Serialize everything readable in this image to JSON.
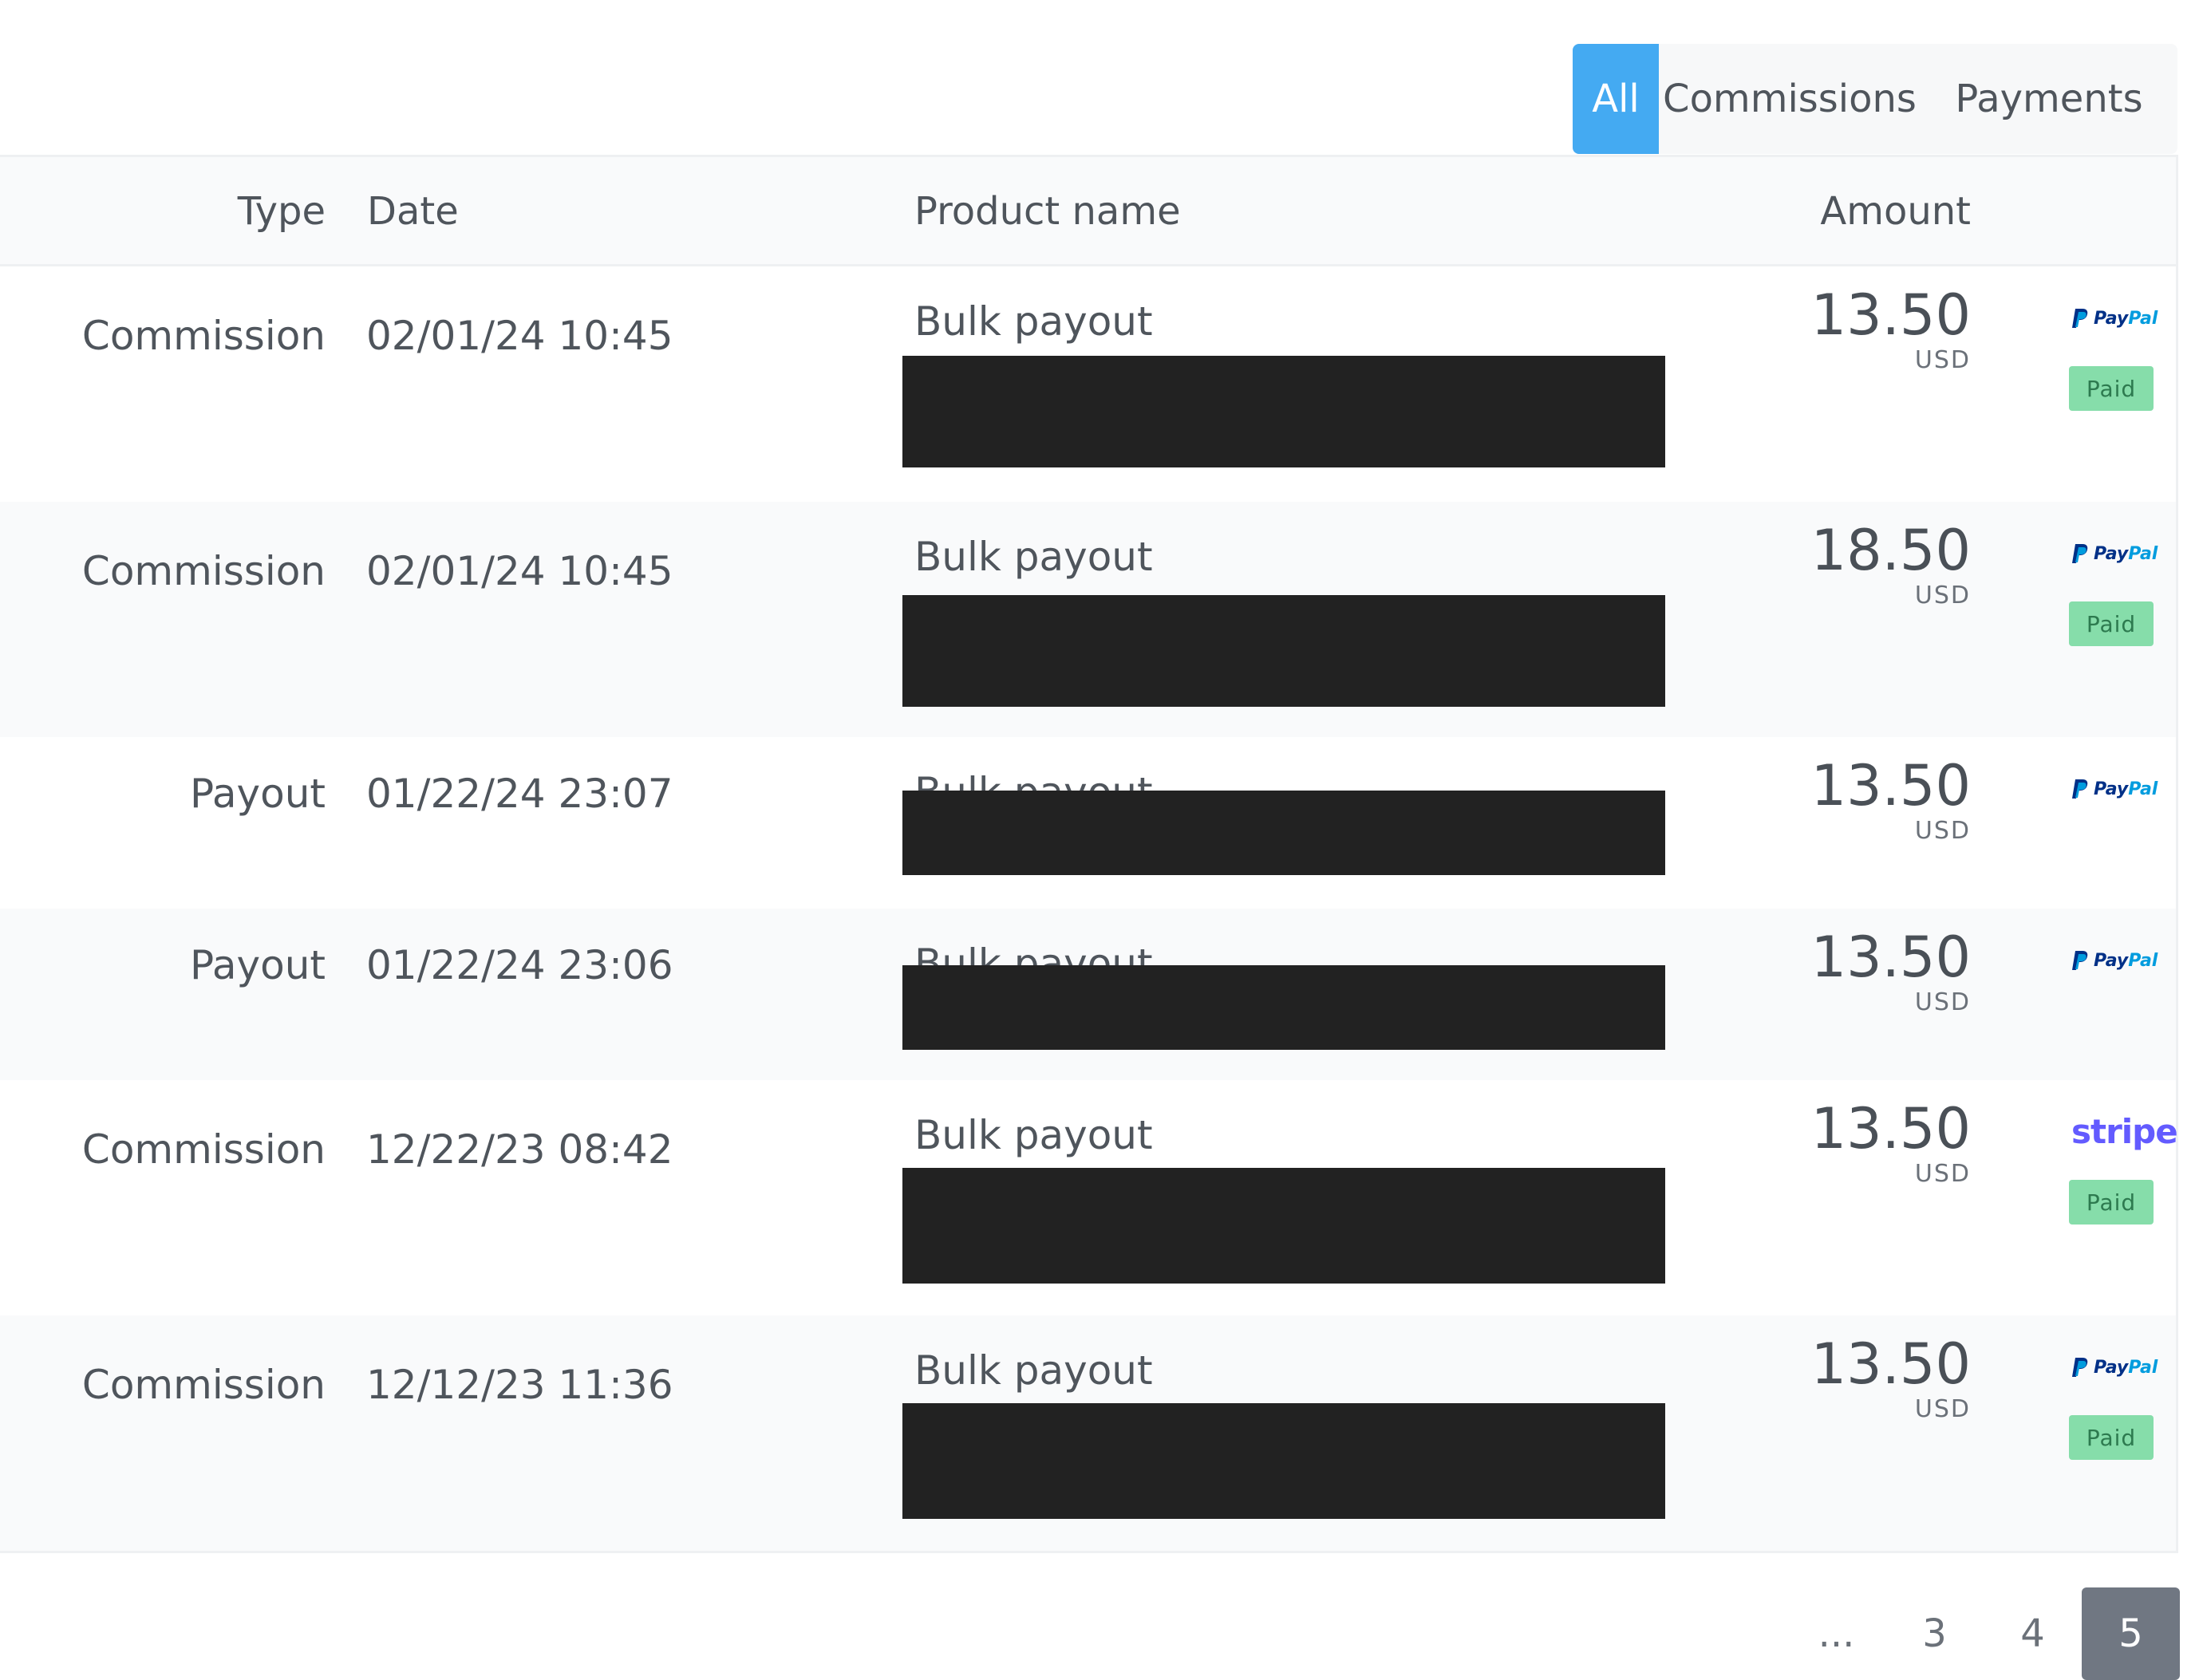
{
  "tabs": {
    "all": "All",
    "commissions": "Commissions",
    "payments": "Payments",
    "active": "All"
  },
  "table": {
    "headers": {
      "type": "Type",
      "date": "Date",
      "product": "Product name",
      "amount": "Amount"
    },
    "rows": [
      {
        "type": "Commission",
        "date": "02/01/24 10:45",
        "product": "Bulk payout",
        "amount": "13.50",
        "currency": "USD",
        "method": "paypal",
        "status": "Paid"
      },
      {
        "type": "Commission",
        "date": "02/01/24 10:45",
        "product": "Bulk payout",
        "amount": "18.50",
        "currency": "USD",
        "method": "paypal",
        "status": "Paid"
      },
      {
        "type": "Payout",
        "date": "01/22/24 23:07",
        "product": "Bulk payout",
        "amount": "13.50",
        "currency": "USD",
        "method": "paypal",
        "status": ""
      },
      {
        "type": "Payout",
        "date": "01/22/24 23:06",
        "product": "Bulk payout",
        "amount": "13.50",
        "currency": "USD",
        "method": "paypal",
        "status": ""
      },
      {
        "type": "Commission",
        "date": "12/22/23 08:42",
        "product": "Bulk payout",
        "amount": "13.50",
        "currency": "USD",
        "method": "stripe",
        "status": "Paid"
      },
      {
        "type": "Commission",
        "date": "12/12/23 11:36",
        "product": "Bulk payout",
        "amount": "13.50",
        "currency": "USD",
        "method": "paypal",
        "status": "Paid"
      }
    ]
  },
  "payment_brands": {
    "paypal_pay": "Pay",
    "paypal_pal": "Pal",
    "stripe": "stripe"
  },
  "pagination": {
    "ellipsis": "...",
    "pages": [
      "3",
      "4",
      "5"
    ],
    "current": "5"
  },
  "colors": {
    "accent": "#44aaf2",
    "paid_badge": "#86ddaa",
    "paid_text": "#2d7a4f",
    "paypal_dark": "#003087",
    "paypal_light": "#009cde",
    "stripe": "#635bff",
    "redaction": "#222222",
    "active_page": "#707782"
  }
}
